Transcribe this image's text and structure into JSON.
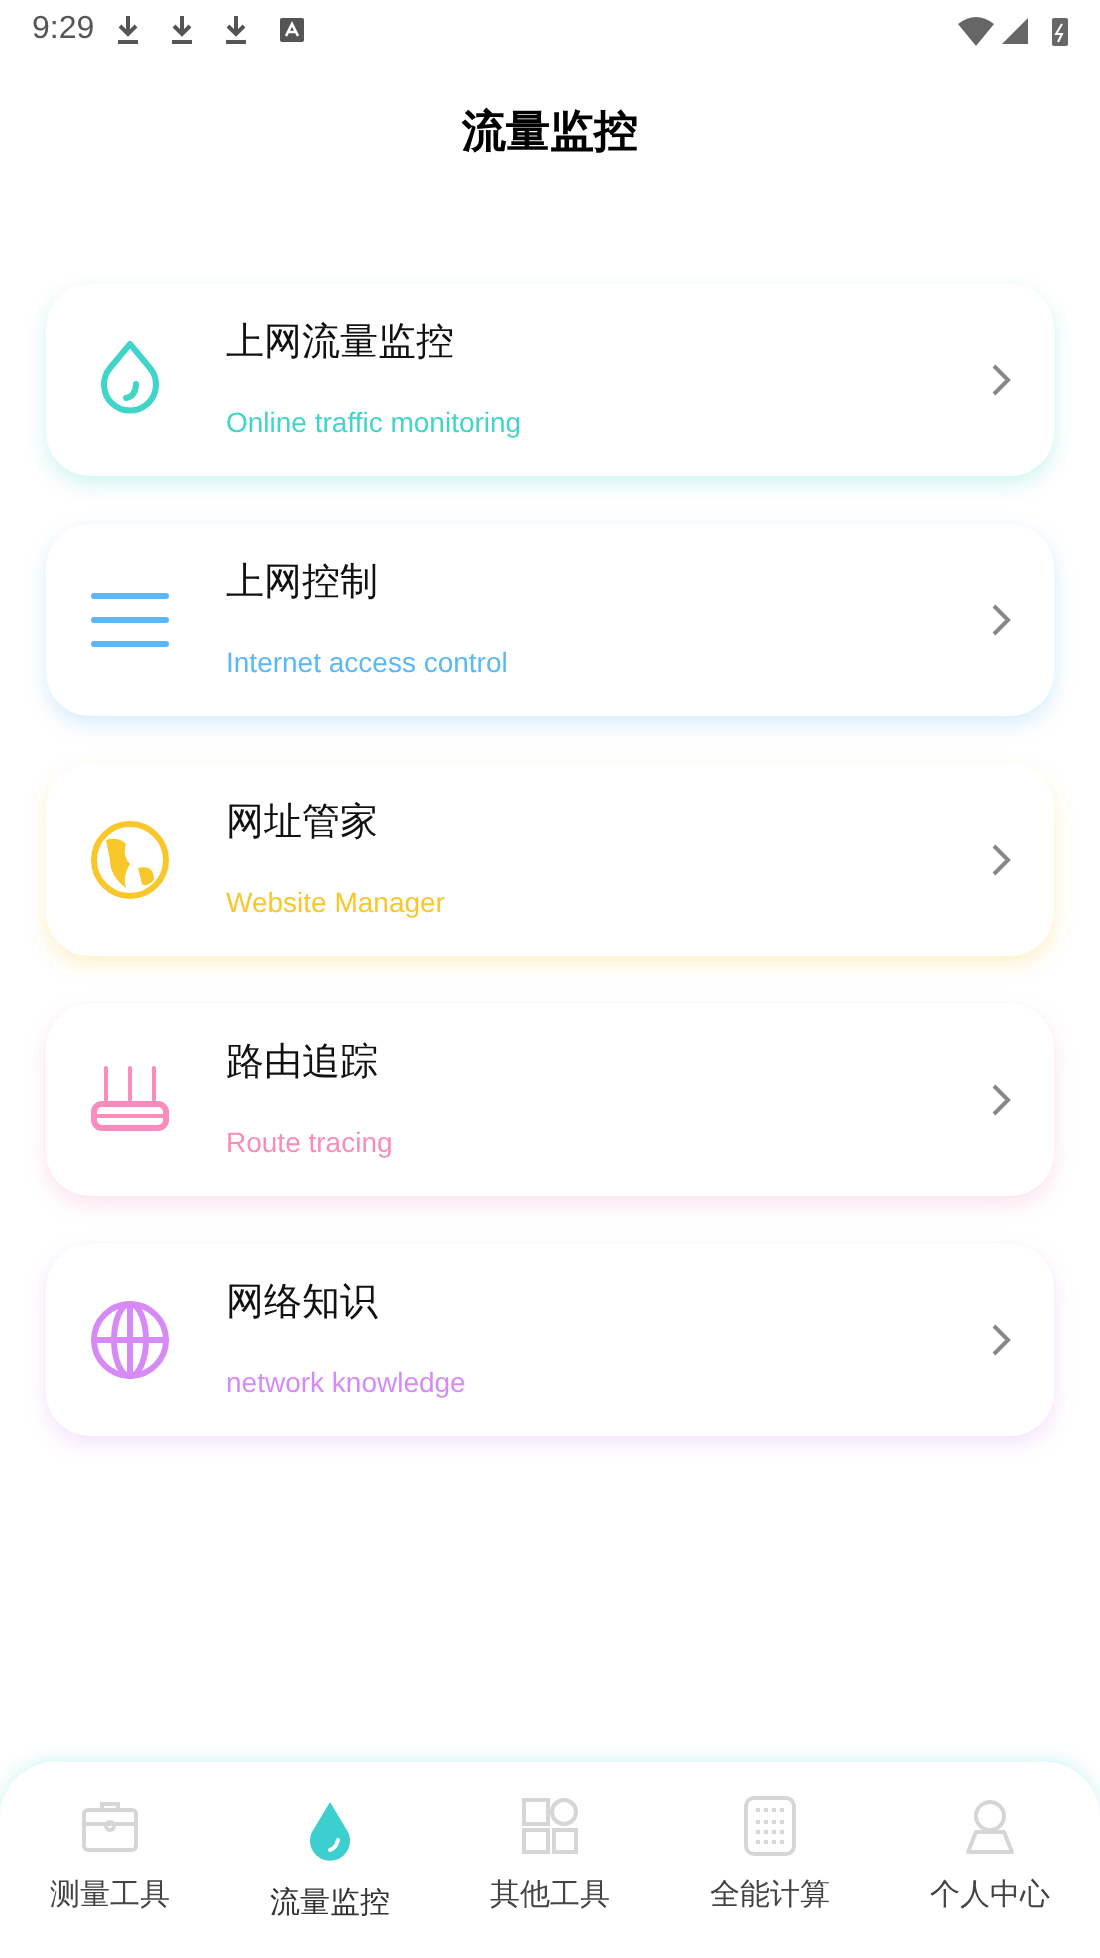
{
  "status_bar": {
    "time": "9:29"
  },
  "title": "流量监控",
  "cards": [
    {
      "kind": "drop",
      "title": "上网流量监控",
      "subtitle": "Online traffic monitoring",
      "color": "#3fd6c9"
    },
    {
      "kind": "lines",
      "title": "上网控制",
      "subtitle": "Internet access control",
      "color": "#5ab8f8"
    },
    {
      "kind": "earth",
      "title": "网址管家",
      "subtitle": "Website Manager",
      "color": "#f9c72a"
    },
    {
      "kind": "router",
      "title": "路由追踪",
      "subtitle": "Route tracing",
      "color": "#f98bbd"
    },
    {
      "kind": "globe",
      "title": "网络知识",
      "subtitle": "network knowledge",
      "color": "#d68af5"
    }
  ],
  "nav": [
    {
      "kind": "briefcase",
      "label": "测量工具",
      "selected": false
    },
    {
      "kind": "drop",
      "label": "流量监控",
      "selected": true
    },
    {
      "kind": "grid",
      "label": "其他工具",
      "selected": false
    },
    {
      "kind": "calculator",
      "label": "全能计算",
      "selected": false
    },
    {
      "kind": "person",
      "label": "个人中心",
      "selected": false
    }
  ]
}
